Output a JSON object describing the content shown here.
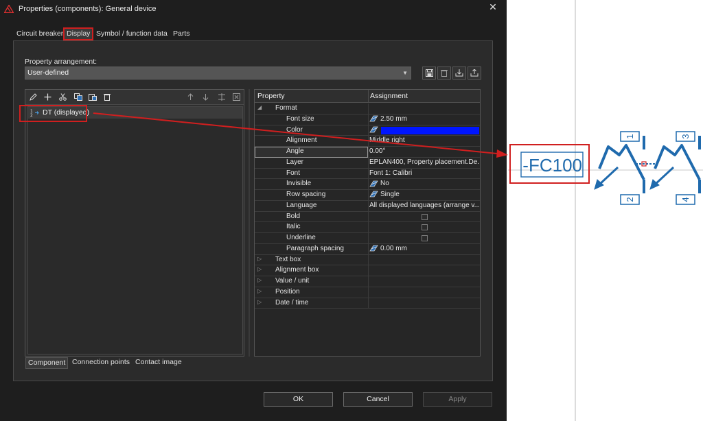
{
  "window": {
    "title": "Properties (components): General device",
    "close_glyph": "✕"
  },
  "tabs": [
    "Circuit breaker",
    "Display",
    "Symbol / function data",
    "Parts"
  ],
  "arrangement": {
    "label": "Property arrangement:",
    "value": "User-defined"
  },
  "tree": {
    "items": [
      {
        "label": "DT (displayed)"
      }
    ]
  },
  "grid": {
    "headers": {
      "property": "Property",
      "assignment": "Assignment"
    },
    "rows": [
      {
        "name": "Format",
        "value": "",
        "group": true,
        "expanded": true
      },
      {
        "name": "Font size",
        "value": "2.50 mm",
        "linked": true
      },
      {
        "name": "Color",
        "value": "",
        "linked": true,
        "swatch": "#0015ff"
      },
      {
        "name": "Alignment",
        "value": "Middle right"
      },
      {
        "name": "Angle",
        "value": "0.00°",
        "selected": true
      },
      {
        "name": "Layer",
        "value": "EPLAN400, Property placement.De..."
      },
      {
        "name": "Font",
        "value": "Font 1: Calibri"
      },
      {
        "name": "Invisible",
        "value": "No",
        "linked": true
      },
      {
        "name": "Row spacing",
        "value": "Single",
        "linked": true
      },
      {
        "name": "Language",
        "value": "All displayed languages (arrange v..."
      },
      {
        "name": "Bold",
        "value": "",
        "checkbox": true
      },
      {
        "name": "Italic",
        "value": "",
        "checkbox": true
      },
      {
        "name": "Underline",
        "value": "",
        "checkbox": true
      },
      {
        "name": "Paragraph spacing",
        "value": "0.00 mm",
        "linked": true
      },
      {
        "name": "Text box",
        "value": "",
        "group": true
      },
      {
        "name": "Alignment box",
        "value": "",
        "group": true
      },
      {
        "name": "Value / unit",
        "value": "",
        "group": true
      },
      {
        "name": "Position",
        "value": "",
        "group": true
      },
      {
        "name": "Date / time",
        "value": "",
        "group": true
      }
    ]
  },
  "bottom_tabs": [
    "Component",
    "Connection points",
    "Contact image"
  ],
  "buttons": {
    "ok": "OK",
    "cancel": "Cancel",
    "apply": "Apply"
  },
  "schematic": {
    "device_tag": "-FC100",
    "pins": [
      "1",
      "2",
      "3",
      "4"
    ]
  },
  "colors": {
    "highlight": "#d01f1f",
    "symbol": "#1f6aad",
    "swatch": "#0015ff"
  }
}
